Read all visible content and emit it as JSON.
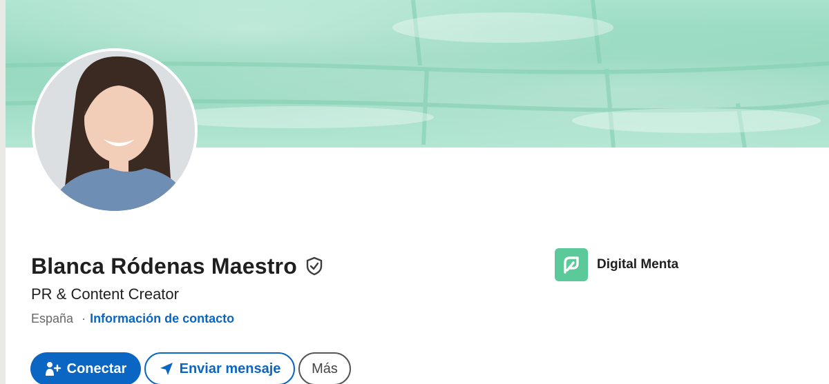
{
  "profile": {
    "name": "Blanca Ródenas Maestro",
    "headline": "PR & Content Creator",
    "location": "España",
    "separator": "·",
    "contact_link": "Información de contacto"
  },
  "company": {
    "name": "Digital Menta",
    "logo_color": "#5cc99a"
  },
  "actions": {
    "connect_label": "Conectar",
    "message_label": "Enviar mensaje",
    "more_label": "Más"
  },
  "icons": {
    "verified": "shield-check-icon",
    "connect": "add-person-icon",
    "message": "send-icon",
    "company_logo": "digital-menta-logo"
  },
  "colors": {
    "accent": "#0a66c2",
    "cover": "#9fdcc5",
    "text": "#1f1f1f",
    "muted": "#666666"
  }
}
